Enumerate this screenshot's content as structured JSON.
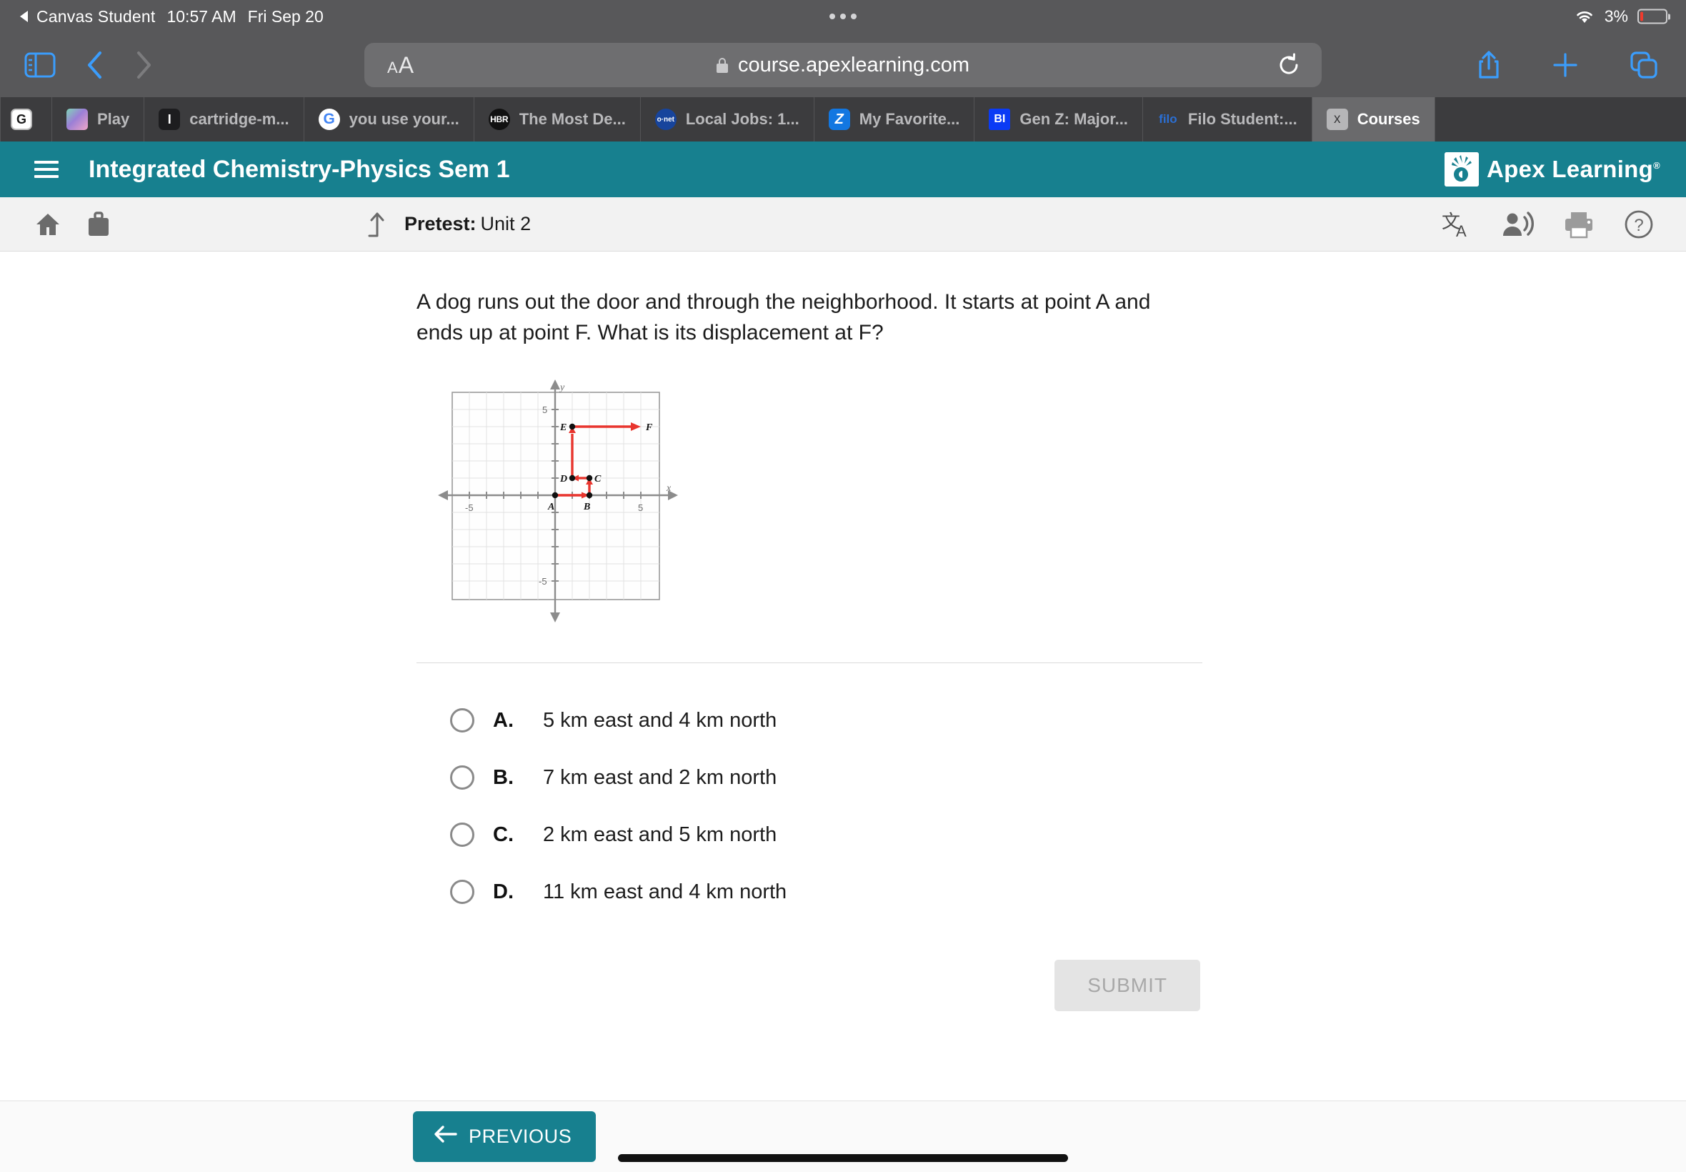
{
  "status_bar": {
    "back_label": "Canvas Student",
    "time": "10:57 AM",
    "date": "Fri Sep 20",
    "battery_percent": "3%",
    "wifi_icon": "wifi-icon",
    "battery_icon": "battery-icon"
  },
  "browser": {
    "sidebar_icon": "sidebar-toggle-icon",
    "back_icon": "chevron-left-icon",
    "forward_icon": "chevron-right-icon",
    "text_size_small": "A",
    "text_size_large": "A",
    "url": "course.apexlearning.com",
    "lock_icon": "lock-icon",
    "reload_icon": "reload-icon",
    "share_icon": "share-icon",
    "new_tab_icon": "plus-icon",
    "tabs_overview_icon": "tabs-overview-icon",
    "tabs": [
      {
        "title": "",
        "favicon": "G",
        "favicon_name": "grammarly-favicon",
        "active": false
      },
      {
        "title": "Play ",
        "favicon": "",
        "favicon_name": "play-favicon",
        "active": false
      },
      {
        "title": "cartridge-m...",
        "favicon": "I",
        "favicon_name": "instructure-favicon",
        "active": false
      },
      {
        "title": "you use your...",
        "favicon": "G",
        "favicon_name": "google-favicon",
        "active": false
      },
      {
        "title": "The Most De...",
        "favicon": "HBR",
        "favicon_name": "hbr-favicon",
        "active": false
      },
      {
        "title": "Local Jobs: 1...",
        "favicon": "o·net",
        "favicon_name": "onet-favicon",
        "active": false
      },
      {
        "title": "My Favorite...",
        "favicon": "Z",
        "favicon_name": "zillow-favicon",
        "active": false
      },
      {
        "title": "Gen Z: Major...",
        "favicon": "BI",
        "favicon_name": "business-insider-favicon",
        "active": false
      },
      {
        "title": "Filo Student:...",
        "favicon": "filo",
        "favicon_name": "filo-favicon",
        "active": false
      },
      {
        "title": "Courses",
        "favicon": "x",
        "favicon_name": "close-tab-icon",
        "active": true
      }
    ]
  },
  "app_header": {
    "menu_icon": "hamburger-menu-icon",
    "course_title": "Integrated Chemistry-Physics Sem 1",
    "brand": "Apex Learning",
    "brand_mark": "apex-learning-logo-icon",
    "registered": "®",
    "accent_color": "#17808f"
  },
  "sub_toolbar": {
    "home_icon": "home-icon",
    "briefcase_icon": "briefcase-icon",
    "level_up_icon": "level-up-arrow-icon",
    "activity_type": "Pretest:",
    "activity_name": "Unit 2",
    "translate_icon": "translate-icon",
    "read_aloud_icon": "read-aloud-icon",
    "print_icon": "print-icon",
    "help_icon": "help-icon"
  },
  "question": {
    "text": "A dog runs out the door and through the neighborhood. It starts at point A and ends up at point F. What is its displacement at F?",
    "choices": [
      {
        "letter": "A.",
        "text": "5 km east and 4 km north",
        "selected": false
      },
      {
        "letter": "B.",
        "text": "7 km east and 2 km north",
        "selected": false
      },
      {
        "letter": "C.",
        "text": "2 km east and 5 km north",
        "selected": false
      },
      {
        "letter": "D.",
        "text": "11 km east and 4 km north",
        "selected": false
      }
    ]
  },
  "chart_data": {
    "type": "scatter",
    "title": "",
    "xlabel": "x",
    "ylabel": "y",
    "xlim": [
      -7,
      7
    ],
    "ylim": [
      -7,
      7
    ],
    "grid": true,
    "tick_labels_x": [
      "-5",
      "5"
    ],
    "tick_labels_y": [
      "5",
      "-5"
    ],
    "points": [
      {
        "label": "A",
        "x": 0,
        "y": 0
      },
      {
        "label": "B",
        "x": 2,
        "y": 0
      },
      {
        "label": "C",
        "x": 2,
        "y": 1
      },
      {
        "label": "D",
        "x": 1,
        "y": 1
      },
      {
        "label": "E",
        "x": 1,
        "y": 4
      },
      {
        "label": "F",
        "x": 5,
        "y": 4
      }
    ],
    "path_segments": [
      {
        "from": "A",
        "to": "B",
        "dx": 2,
        "dy": 0
      },
      {
        "from": "B",
        "to": "C",
        "dx": 0,
        "dy": 1
      },
      {
        "from": "C",
        "to": "D",
        "dx": -1,
        "dy": 0
      },
      {
        "from": "D",
        "to": "E",
        "dx": 0,
        "dy": 3
      },
      {
        "from": "E",
        "to": "F",
        "dx": 4,
        "dy": 0
      }
    ],
    "path_color": "#e8352e",
    "point_color": "#111111"
  },
  "actions": {
    "submit_label": "SUBMIT",
    "submit_enabled": false,
    "previous_label": "PREVIOUS",
    "previous_arrow_icon": "arrow-left-icon"
  }
}
